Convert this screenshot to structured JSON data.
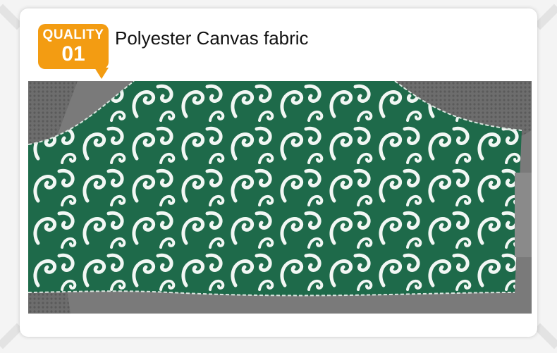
{
  "badge": {
    "label": "QUALITY",
    "number": "01"
  },
  "headline": "Polyester Canvas fabric",
  "colors": {
    "badge": "#f39c12",
    "fabric_green": "#1e6a4a",
    "swirl": "#f2f7f4",
    "mesh_gray": "#6d6d6d"
  },
  "photo": {
    "subject": "green fabric with white swirl pattern on gray mesh"
  }
}
